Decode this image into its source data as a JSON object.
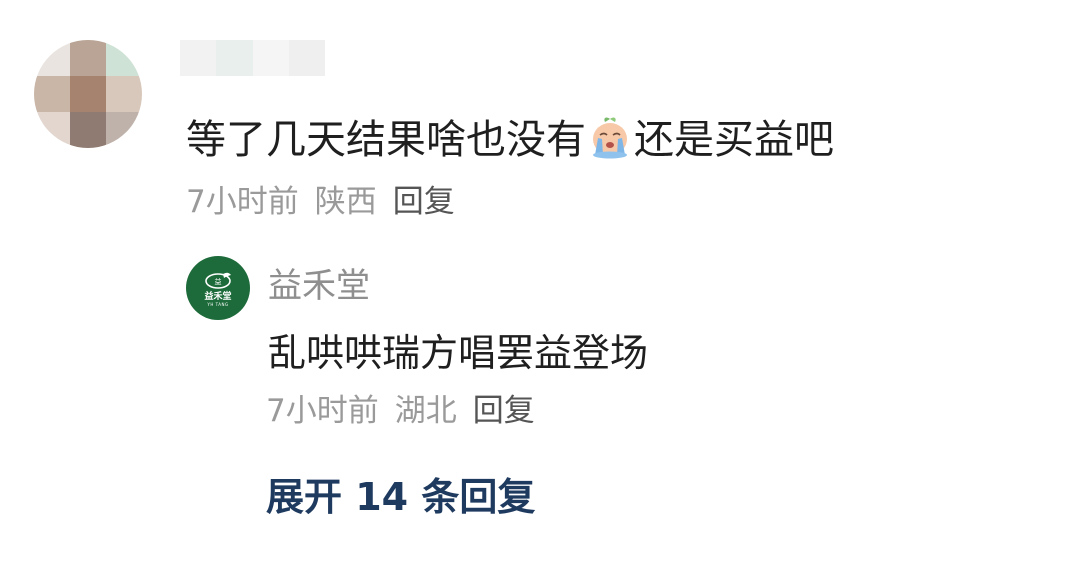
{
  "comment": {
    "text_before_emoji": "等了几天结果啥也没有",
    "emoji": "crying-face-emoji",
    "text_after_emoji": "还是买益吧",
    "time": "7小时前",
    "location": "陕西",
    "reply_label": "回复"
  },
  "reply": {
    "author": "益禾堂",
    "avatar_logo_text": "益禾堂",
    "avatar_logo_sub": "YH TANG",
    "text": "乱哄哄瑞方唱罢益登场",
    "time": "7小时前",
    "location": "湖北",
    "reply_label": "回复"
  },
  "expand_replies_label": "展开 14 条回复",
  "colors": {
    "text_primary": "#1f1f1f",
    "text_meta": "#9a9a9a",
    "link_dark_blue": "#1f3a5f",
    "brand_green": "#1d6b3a"
  }
}
